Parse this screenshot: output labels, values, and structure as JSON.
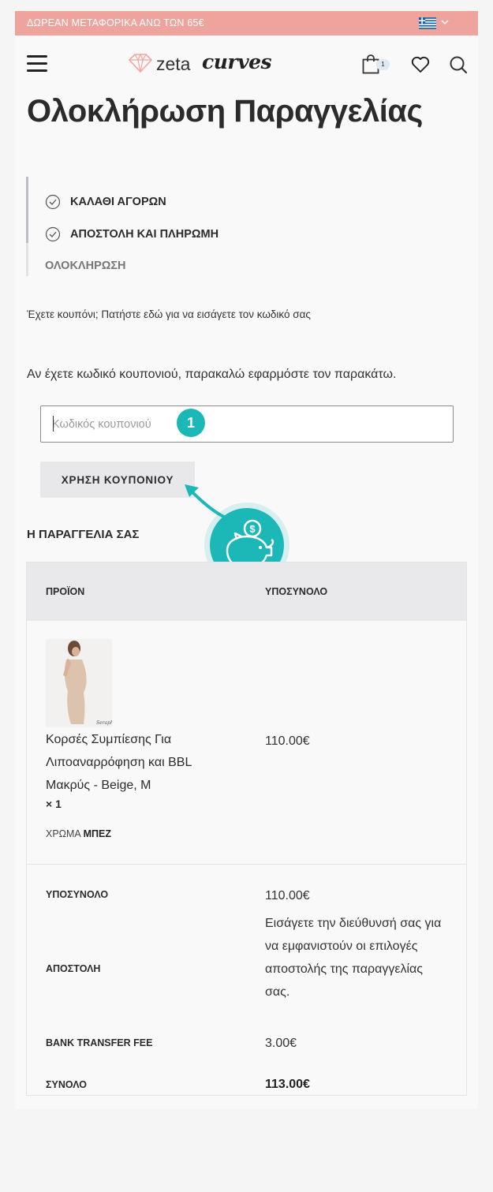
{
  "promo_bar": {
    "text": "ΔΩΡΕΑΝ ΜΕΤΑΦΟΡΙΚΑ ΑΝΩ ΤΩΝ 65€",
    "language_flag": "greek-flag-icon"
  },
  "header": {
    "logo": {
      "part1": "zeta",
      "part2": "curves"
    },
    "cart_count": "1",
    "icons": [
      "menu-icon",
      "diamond-icon",
      "shopping-bag-icon",
      "heart-icon",
      "search-icon"
    ]
  },
  "page_title": "Ολοκλήρωση Παραγγελίας",
  "checkout_steps": [
    {
      "label": "ΚΑΛΑΘΙ ΑΓΟΡΩΝ",
      "done": true
    },
    {
      "label": "ΑΠΟΣΤΟΛΗ ΚΑΙ ΠΛΗΡΩΜΗ",
      "done": true
    },
    {
      "label": "ΟΛΟΚΛΗΡΩΣΗ",
      "done": false
    }
  ],
  "coupon": {
    "toggle_text": "Έχετε κουπόνι; Πατήστε εδώ για να εισάγετε τον κωδικό σας",
    "intro": "Αν έχετε κωδικό κουπονιού, παρακαλώ εφαρμόστε τον παρακάτω.",
    "placeholder": "Κωδικός κουπονιού",
    "value": "",
    "apply_label": "ΧΡΗΣΗ ΚΟΥΠΟΝΙΟΥ",
    "step_marker": "1"
  },
  "order": {
    "heading": "Η ΠΑΡΑΓΓΕΛΙΑ ΣΑΣ",
    "columns": [
      "ΠΡΟΪΟΝ",
      "ΥΠΟΣΥΝΟΛΟ"
    ],
    "item": {
      "name": "Κορσές Συμπίεσης Για Λιποαναρρόφηση και BBL Μακρύς - Beige, M",
      "quantity": "× 1",
      "attribute_label": "ΧΡΩΜΑ",
      "attribute_value": "ΜΠΕΖ",
      "price": "110.00€"
    },
    "totals": {
      "subtotal_label": "ΥΠΟΣΥΝΟΛΟ",
      "subtotal_value": "110.00€",
      "shipping_label": "ΑΠΟΣΤΟΛΗ",
      "shipping_value": "Εισάγετε την διεύθυνσή σας για να εμφανιστούν οι επιλογές αποστολής της παραγγελίας σας.",
      "fee_label": "BANK TRANSFER FEE",
      "fee_value": "3.00€",
      "total_label": "ΣΥΝΟΛΟ",
      "total_value": "113.00€"
    }
  },
  "colors": {
    "promo_bg": "#eea39d",
    "accent_teal": "#1cb7b7",
    "button_bg": "#e8e8eb",
    "table_head_bg": "#e9e9ec"
  }
}
